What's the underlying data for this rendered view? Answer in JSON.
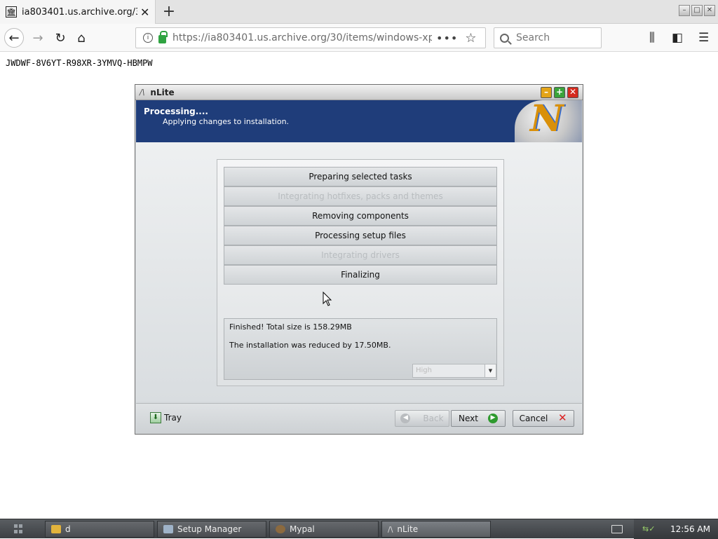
{
  "browser": {
    "tab_title": "ia803401.us.archive.org/30/i",
    "url": "https://ia803401.us.archive.org/30/items/windows-xp",
    "search_placeholder": "Search",
    "new_tab": "+",
    "tab_close": "✕"
  },
  "page": {
    "key_text": "JWDWF-8V6YT-R98XR-3YMVQ-HBMPW"
  },
  "nlite": {
    "title": "nLite",
    "header_title": "Processing....",
    "header_subtitle": "Applying changes to installation.",
    "tasks": [
      {
        "label": "Preparing selected tasks",
        "dim": false
      },
      {
        "label": "Integrating hotfixes, packs and themes",
        "dim": true
      },
      {
        "label": "Removing components",
        "dim": false
      },
      {
        "label": "Processing setup files",
        "dim": false
      },
      {
        "label": "Integrating drivers",
        "dim": true
      },
      {
        "label": "Finalizing",
        "dim": false
      }
    ],
    "result_line1": "Finished! Total size is 158.29MB",
    "result_line2": "The installation was reduced by 17.50MB.",
    "priority_value": "High",
    "tray_label": "Tray",
    "back_label": "Back",
    "next_label": "Next",
    "cancel_label": "Cancel"
  },
  "taskbar": {
    "items": [
      {
        "label": "d",
        "icon": "folder-icon"
      },
      {
        "label": "Setup Manager",
        "icon": "setup-icon"
      },
      {
        "label": "Mypal",
        "icon": "browser-icon"
      },
      {
        "label": "nLite",
        "icon": "nlite-icon"
      }
    ],
    "clock": "12:56 AM"
  }
}
